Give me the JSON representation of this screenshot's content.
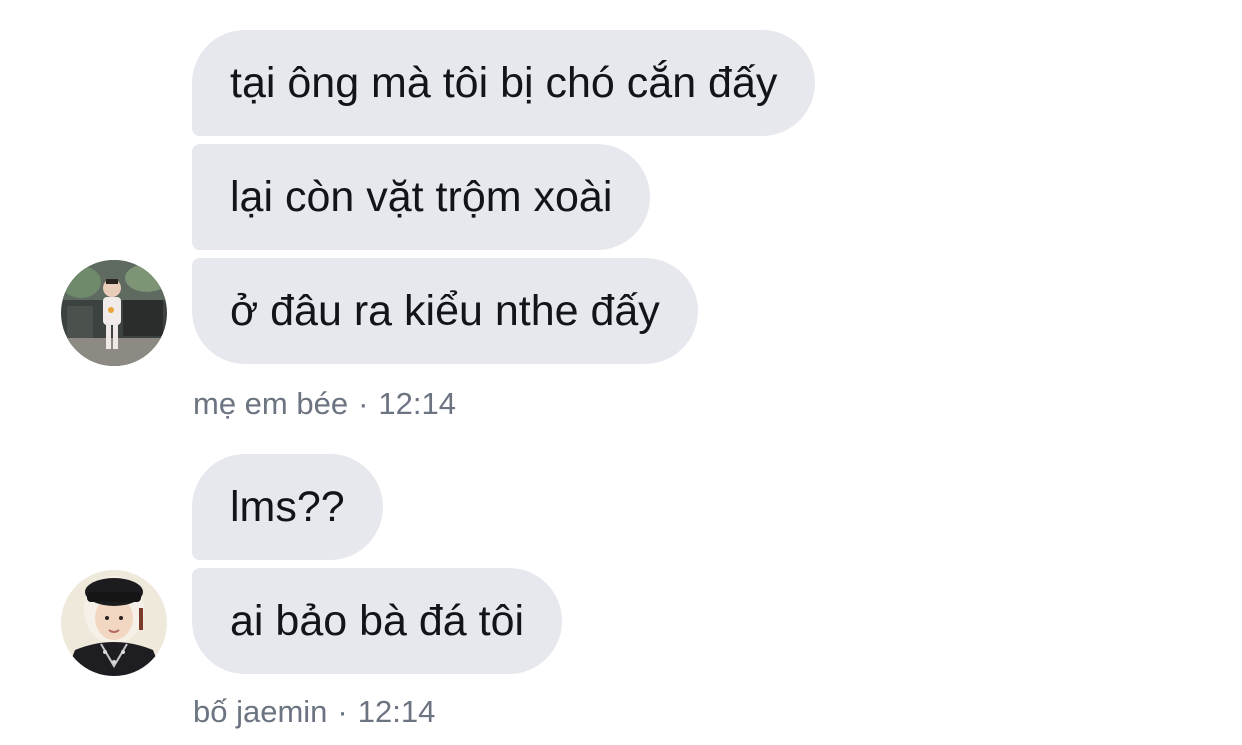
{
  "groups": [
    {
      "sender": "mẹ em bée",
      "time": "12:14",
      "avatar": "toddler-photo-avatar",
      "messages": [
        "tại ông mà tôi bị chó cắn đấy",
        "lại còn vặt trộm xoài",
        "ở đâu ra kiểu nthe đấy"
      ]
    },
    {
      "sender": "bố jaemin",
      "time": "12:14",
      "avatar": "boy-in-black-hat-avatar",
      "messages": [
        "lms??",
        "ai bảo bà đá tôi"
      ]
    }
  ],
  "separator": "·",
  "colors": {
    "bubble": "#e6e8ed",
    "text": "#111418",
    "meta": "#6b7480"
  }
}
